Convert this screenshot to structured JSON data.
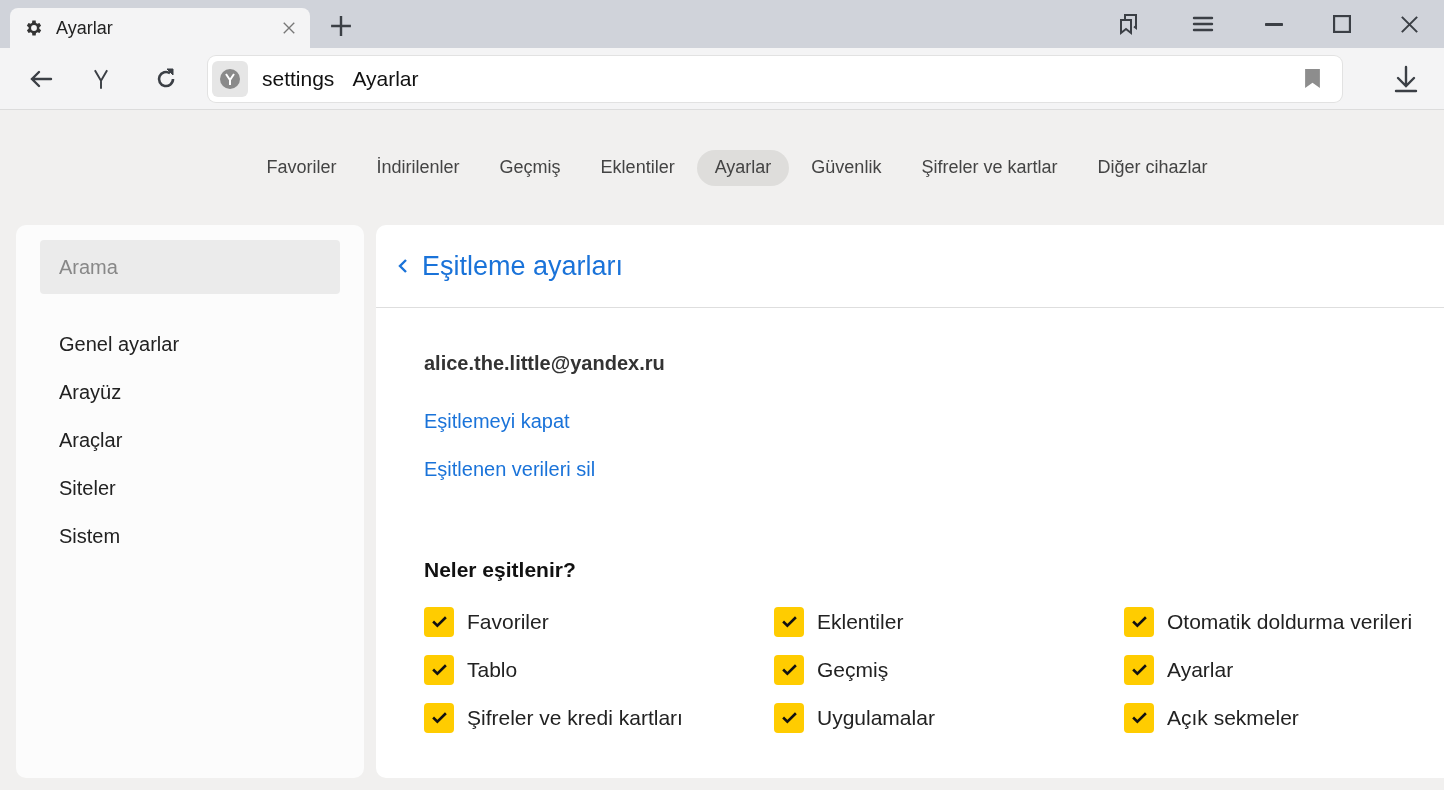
{
  "tab": {
    "title": "Ayarlar"
  },
  "address": {
    "host": "settings",
    "title": "Ayarlar"
  },
  "nav": [
    {
      "label": "Favoriler",
      "selected": false
    },
    {
      "label": "İndirilenler",
      "selected": false
    },
    {
      "label": "Geçmiş",
      "selected": false
    },
    {
      "label": "Eklentiler",
      "selected": false
    },
    {
      "label": "Ayarlar",
      "selected": true
    },
    {
      "label": "Güvenlik",
      "selected": false
    },
    {
      "label": "Şifreler ve kartlar",
      "selected": false
    },
    {
      "label": "Diğer cihazlar",
      "selected": false
    }
  ],
  "sidebar": {
    "search": {
      "placeholder": "Arama"
    },
    "items": [
      "Genel ayarlar",
      "Arayüz",
      "Araçlar",
      "Siteler",
      "Sistem"
    ]
  },
  "panel": {
    "title": "Eşitleme ayarları",
    "account": "alice.the.little@yandex.ru",
    "links": [
      "Eşitlemeyi kapat",
      "Eşitlenen verileri sil"
    ],
    "section_title": "Neler eşitlenir?",
    "options": [
      {
        "label": "Favoriler",
        "checked": true
      },
      {
        "label": "Eklentiler",
        "checked": true
      },
      {
        "label": "Otomatik doldurma verileri",
        "checked": true
      },
      {
        "label": "Tablo",
        "checked": true
      },
      {
        "label": "Geçmiş",
        "checked": true
      },
      {
        "label": "Ayarlar",
        "checked": true
      },
      {
        "label": "Şifreler ve kredi kartları",
        "checked": true
      },
      {
        "label": "Uygulamalar",
        "checked": true
      },
      {
        "label": "Açık sekmeler",
        "checked": true
      }
    ]
  }
}
